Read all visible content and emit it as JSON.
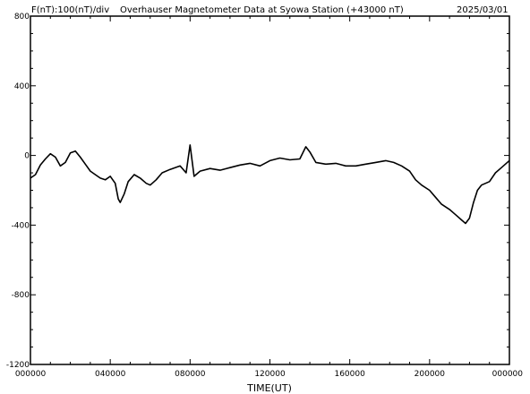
{
  "header": {
    "left": "F(nT):100(nT)/div",
    "title": "Overhauser Magnetometer Data at Syowa Station (+43000 nT)",
    "date": "2025/03/01"
  },
  "chart_data": {
    "type": "line",
    "title": "Overhauser Magnetometer Data at Syowa Station (+43000 nT)",
    "xlabel": "TIME(UT)",
    "ylabel": "F(nT):100(nT)/div",
    "xlim": [
      0,
      24
    ],
    "ylim": [
      -1200,
      800
    ],
    "y_ticks": [
      -1200,
      -800,
      -400,
      0,
      400,
      800
    ],
    "x_ticks": [
      {
        "hour": 0,
        "label": "000000"
      },
      {
        "hour": 4,
        "label": "040000"
      },
      {
        "hour": 8,
        "label": "080000"
      },
      {
        "hour": 12,
        "label": "120000"
      },
      {
        "hour": 16,
        "label": "160000"
      },
      {
        "hour": 20,
        "label": "200000"
      },
      {
        "hour": 24,
        "label": "000000"
      }
    ],
    "grid": false,
    "series": [
      {
        "color": "#000000",
        "points": [
          [
            0.0,
            -130
          ],
          [
            0.25,
            -110
          ],
          [
            0.5,
            -55
          ],
          [
            0.75,
            -20
          ],
          [
            1.0,
            10
          ],
          [
            1.25,
            -10
          ],
          [
            1.5,
            -60
          ],
          [
            1.75,
            -40
          ],
          [
            2.0,
            15
          ],
          [
            2.25,
            25
          ],
          [
            2.5,
            -10
          ],
          [
            2.75,
            -50
          ],
          [
            3.0,
            -90
          ],
          [
            3.25,
            -110
          ],
          [
            3.5,
            -130
          ],
          [
            3.75,
            -140
          ],
          [
            4.0,
            -120
          ],
          [
            4.25,
            -160
          ],
          [
            4.4,
            -250
          ],
          [
            4.5,
            -270
          ],
          [
            4.7,
            -220
          ],
          [
            4.9,
            -150
          ],
          [
            5.2,
            -110
          ],
          [
            5.5,
            -130
          ],
          [
            5.8,
            -160
          ],
          [
            6.0,
            -170
          ],
          [
            6.3,
            -140
          ],
          [
            6.6,
            -100
          ],
          [
            7.0,
            -80
          ],
          [
            7.5,
            -60
          ],
          [
            7.8,
            -100
          ],
          [
            8.0,
            60
          ],
          [
            8.2,
            -120
          ],
          [
            8.5,
            -90
          ],
          [
            9.0,
            -75
          ],
          [
            9.5,
            -85
          ],
          [
            10.0,
            -70
          ],
          [
            10.5,
            -55
          ],
          [
            11.0,
            -45
          ],
          [
            11.5,
            -60
          ],
          [
            12.0,
            -30
          ],
          [
            12.5,
            -15
          ],
          [
            13.0,
            -25
          ],
          [
            13.5,
            -20
          ],
          [
            13.8,
            50
          ],
          [
            14.0,
            20
          ],
          [
            14.3,
            -40
          ],
          [
            14.8,
            -50
          ],
          [
            15.3,
            -45
          ],
          [
            15.8,
            -60
          ],
          [
            16.3,
            -60
          ],
          [
            16.8,
            -50
          ],
          [
            17.3,
            -40
          ],
          [
            17.8,
            -30
          ],
          [
            18.2,
            -40
          ],
          [
            18.6,
            -60
          ],
          [
            19.0,
            -90
          ],
          [
            19.3,
            -140
          ],
          [
            19.6,
            -170
          ],
          [
            20.0,
            -200
          ],
          [
            20.3,
            -240
          ],
          [
            20.6,
            -280
          ],
          [
            21.0,
            -310
          ],
          [
            21.3,
            -340
          ],
          [
            21.6,
            -370
          ],
          [
            21.8,
            -390
          ],
          [
            22.0,
            -360
          ],
          [
            22.2,
            -270
          ],
          [
            22.4,
            -200
          ],
          [
            22.6,
            -170
          ],
          [
            23.0,
            -150
          ],
          [
            23.3,
            -100
          ],
          [
            23.6,
            -70
          ],
          [
            23.8,
            -50
          ],
          [
            24.0,
            -30
          ]
        ]
      }
    ]
  }
}
